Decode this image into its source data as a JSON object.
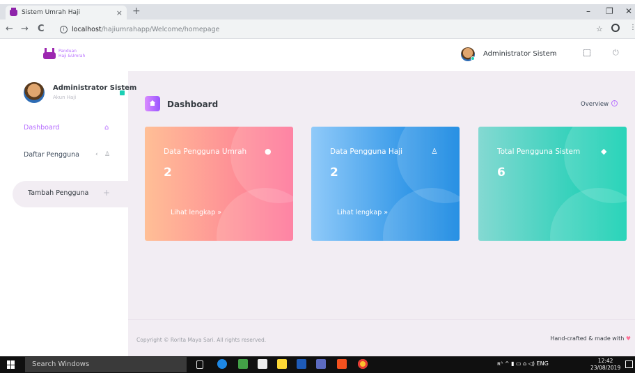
{
  "browser": {
    "tab_title": "Sistem Umrah Haji",
    "tab_close": "×",
    "new_tab": "+",
    "url_host": "localhost",
    "url_path": "/hajiumrahapp/Welcome/homepage",
    "back": "←",
    "forward": "→",
    "reload": "C",
    "star": "☆",
    "menu": "⋮",
    "minimize": "–",
    "maximize": "❐",
    "close": "✕"
  },
  "logo": {
    "line1": "Panduan",
    "line2": "Haji &Umrah"
  },
  "topnav": {
    "user_name": "Administrator Sistem",
    "caret": "⌄",
    "power": "⏻"
  },
  "sidebar": {
    "profile_name": "Administrator Sistem",
    "profile_role": "Akun Haji",
    "items": [
      {
        "label": "Dashboard",
        "icon": "home-icon",
        "glyph": "⌂"
      },
      {
        "label": "Daftar Pengguna",
        "icon": "user-icon",
        "glyph": "‹ ♙"
      }
    ],
    "add_button": {
      "label": "Tambah Pengguna",
      "glyph": "+"
    }
  },
  "main": {
    "title": "Dashboard",
    "overview": "Overview",
    "overview_glyph": "i",
    "cards": [
      {
        "title": "Data Pengguna Umrah",
        "value": "2",
        "link": "Lihat lengkap »",
        "icon_glyph": "●",
        "icon": "user-icon",
        "color_from": "#ffbf96",
        "color_to": "#fe7096"
      },
      {
        "title": "Data Pengguna Haji",
        "value": "2",
        "link": "Lihat lengkap »",
        "icon_glyph": "♙",
        "icon": "user-outline-icon",
        "color_from": "#90caf9",
        "color_to": "#047edf"
      },
      {
        "title": "Total Pengguna Sistem",
        "value": "6",
        "link": "",
        "icon_glyph": "◆",
        "icon": "diamond-icon",
        "color_from": "#84d9d2",
        "color_to": "#07cdae"
      }
    ]
  },
  "footer": {
    "copyright": "Copyright © Rorita Maya Sari. All rights reserved.",
    "right": "Hand-crafted & made with",
    "heart": "♥"
  },
  "taskbar": {
    "search_placeholder": "Search Windows",
    "tray": "ʀᴬ  ^  ▮  ▭  ⌂  ◁)  ENG",
    "time": "12:42",
    "date": "23/08/2019"
  },
  "colors": {
    "accent": "#b66dff",
    "page_bg": "#f2edf3"
  }
}
